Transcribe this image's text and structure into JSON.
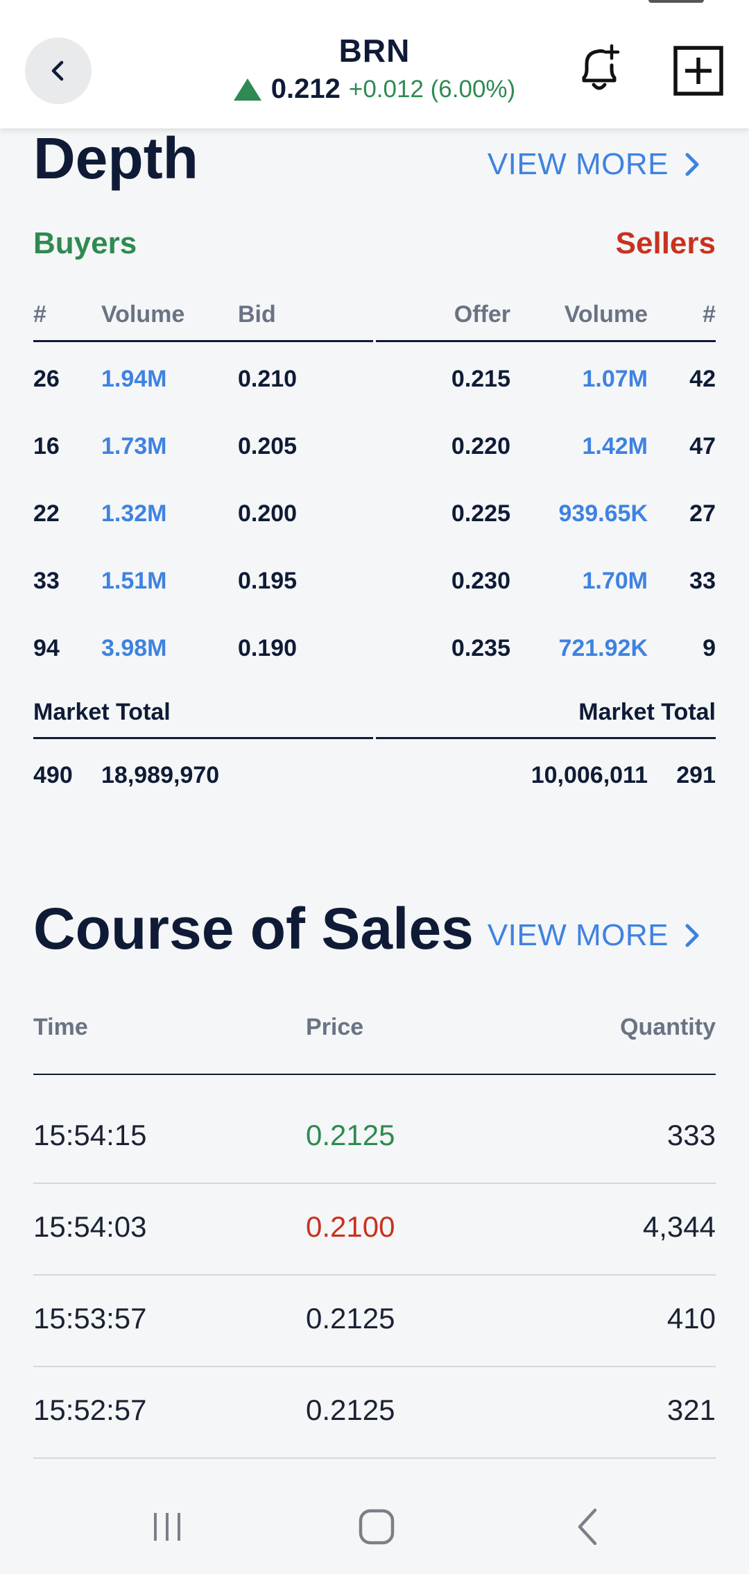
{
  "header": {
    "ticker": "BRN",
    "last_price": "0.212",
    "change": "+0.012 (6.00%)",
    "icons": [
      "back-arrow-icon",
      "bell-plus-icon",
      "add-square-icon"
    ],
    "colors": {
      "up": "#2e8a52",
      "down": "#c8321f",
      "accent": "#3f82e0"
    }
  },
  "depth": {
    "title": "Depth",
    "view_more": "VIEW MORE",
    "buyers_label": "Buyers",
    "sellers_label": "Sellers",
    "headers": {
      "buy_count": "#",
      "buy_volume": "Volume",
      "bid": "Bid",
      "offer": "Offer",
      "sell_volume": "Volume",
      "sell_count": "#"
    },
    "rows": [
      {
        "buy_count": "26",
        "buy_volume": "1.94M",
        "bid": "0.210",
        "offer": "0.215",
        "sell_volume": "1.07M",
        "sell_count": "42"
      },
      {
        "buy_count": "16",
        "buy_volume": "1.73M",
        "bid": "0.205",
        "offer": "0.220",
        "sell_volume": "1.42M",
        "sell_count": "47"
      },
      {
        "buy_count": "22",
        "buy_volume": "1.32M",
        "bid": "0.200",
        "offer": "0.225",
        "sell_volume": "939.65K",
        "sell_count": "27"
      },
      {
        "buy_count": "33",
        "buy_volume": "1.51M",
        "bid": "0.195",
        "offer": "0.230",
        "sell_volume": "1.70M",
        "sell_count": "33"
      },
      {
        "buy_count": "94",
        "buy_volume": "3.98M",
        "bid": "0.190",
        "offer": "0.235",
        "sell_volume": "721.92K",
        "sell_count": "9"
      }
    ],
    "market_total_label_buy": "Market Total",
    "market_total_label_sell": "Market Total",
    "totals": {
      "buy_count": "490",
      "buy_volume": "18,989,970",
      "sell_volume": "10,006,011",
      "sell_count": "291"
    }
  },
  "course_of_sales": {
    "title": "Course of Sales",
    "view_more": "VIEW MORE",
    "headers": {
      "time": "Time",
      "price": "Price",
      "quantity": "Quantity"
    },
    "rows": [
      {
        "time": "15:54:15",
        "price": "0.2125",
        "quantity": "333",
        "direction": "up"
      },
      {
        "time": "15:54:03",
        "price": "0.2100",
        "quantity": "4,344",
        "direction": "down"
      },
      {
        "time": "15:53:57",
        "price": "0.2125",
        "quantity": "410",
        "direction": "none"
      },
      {
        "time": "15:52:57",
        "price": "0.2125",
        "quantity": "321",
        "direction": "none"
      }
    ]
  },
  "navbar": {
    "icons": [
      "recent-apps-icon",
      "home-icon",
      "back-icon"
    ]
  }
}
